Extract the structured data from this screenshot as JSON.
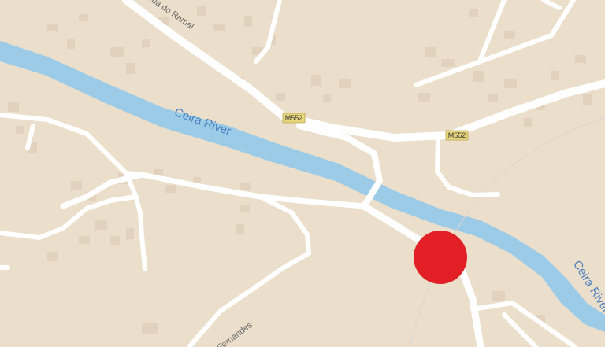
{
  "colors": {
    "land": "#ebdfcc",
    "water": "#9ccbe8",
    "road": "#ffffff",
    "building": "#e2d2bd",
    "shield": "#e8d67c",
    "marker": "#e31f26"
  },
  "labels": {
    "river_upper": "Ceira River",
    "river_lower": "Ceira River",
    "rua_do_ramal": "Rua do Ramal",
    "fernandes": "A. Fernandes",
    "route_shield_1": "M552",
    "route_shield_2": "M552"
  },
  "marker": {
    "icon": "location-dot-icon"
  }
}
